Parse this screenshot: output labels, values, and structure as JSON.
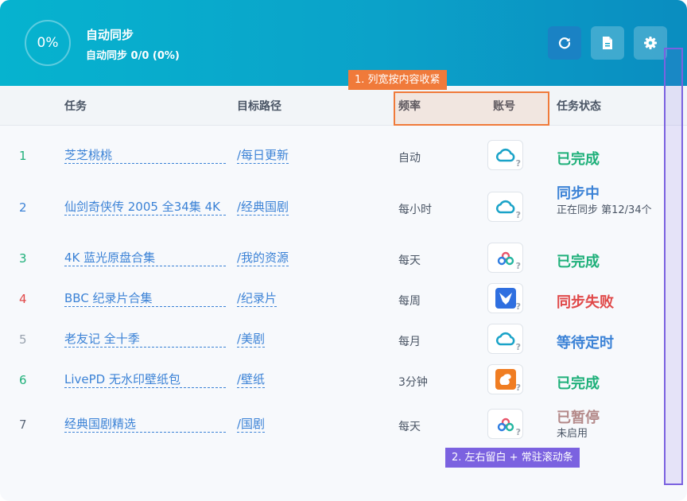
{
  "header": {
    "progress": "0%",
    "title": "自动同步",
    "subtitle": "自动同步 0/0 (0%)",
    "buttons": [
      {
        "name": "refresh",
        "icon": "refresh-icon"
      },
      {
        "name": "file",
        "icon": "file-icon"
      },
      {
        "name": "settings",
        "icon": "gear-icon"
      }
    ]
  },
  "table": {
    "columns": {
      "task": "任务",
      "path": "目标路径",
      "freq": "频率",
      "account": "账号",
      "status": "任务状态"
    },
    "rows": [
      {
        "index": "1",
        "task": "芝芝桃桃",
        "path": "/每日更新",
        "freq": "自动",
        "account_icon": "cloud-icon",
        "status": "已完成",
        "status_sub": "",
        "index_color": "#1fb07a",
        "status_color": "#1fb07a"
      },
      {
        "index": "2",
        "task": "仙剑奇侠传 2005 全34集 4K",
        "path": "/经典国剧",
        "freq": "每小时",
        "account_icon": "cloud-icon",
        "status": "同步中",
        "status_sub": "正在同步 第12/34个",
        "index_color": "#3b82d6",
        "status_color": "#3b82d6"
      },
      {
        "index": "3",
        "task": "4K 蓝光原盘合集",
        "path": "/我的资源",
        "freq": "每天",
        "account_icon": "tricolor-cloud-icon",
        "status": "已完成",
        "status_sub": "",
        "index_color": "#1fb07a",
        "status_color": "#1fb07a"
      },
      {
        "index": "4",
        "task": "BBC 纪录片合集",
        "path": "/纪录片",
        "freq": "每周",
        "account_icon": "swallow-icon",
        "status": "同步失败",
        "status_sub": "",
        "index_color": "#e04848",
        "status_color": "#e04848"
      },
      {
        "index": "5",
        "task": "老友记 全十季",
        "path": "/美剧",
        "freq": "每月",
        "account_icon": "cloud-icon",
        "status": "等待定时",
        "status_sub": "",
        "index_color": "#98a2ae",
        "status_color": "#3b82d6"
      },
      {
        "index": "6",
        "task": "LivePD 无水印壁纸包",
        "path": "/壁纸",
        "freq": "3分钟",
        "account_icon": "squirrel-icon",
        "status": "已完成",
        "status_sub": "",
        "index_color": "#1fb07a",
        "status_color": "#1fb07a"
      },
      {
        "index": "7",
        "task": "经典国剧精选",
        "path": "/国剧",
        "freq": "每天",
        "account_icon": "tricolor-cloud-icon",
        "status": "已暂停",
        "status_sub": "未启用",
        "index_color": "#5a6778",
        "status_color": "#b48a8a"
      }
    ]
  },
  "annotations": {
    "first": "1. 列宽按内容收紧",
    "second": "2. 左右留白 + 常驻滚动条"
  },
  "colors": {
    "accent": "#06b3cf",
    "annotation_orange": "#f07a3a",
    "annotation_purple": "#7b62e0"
  }
}
